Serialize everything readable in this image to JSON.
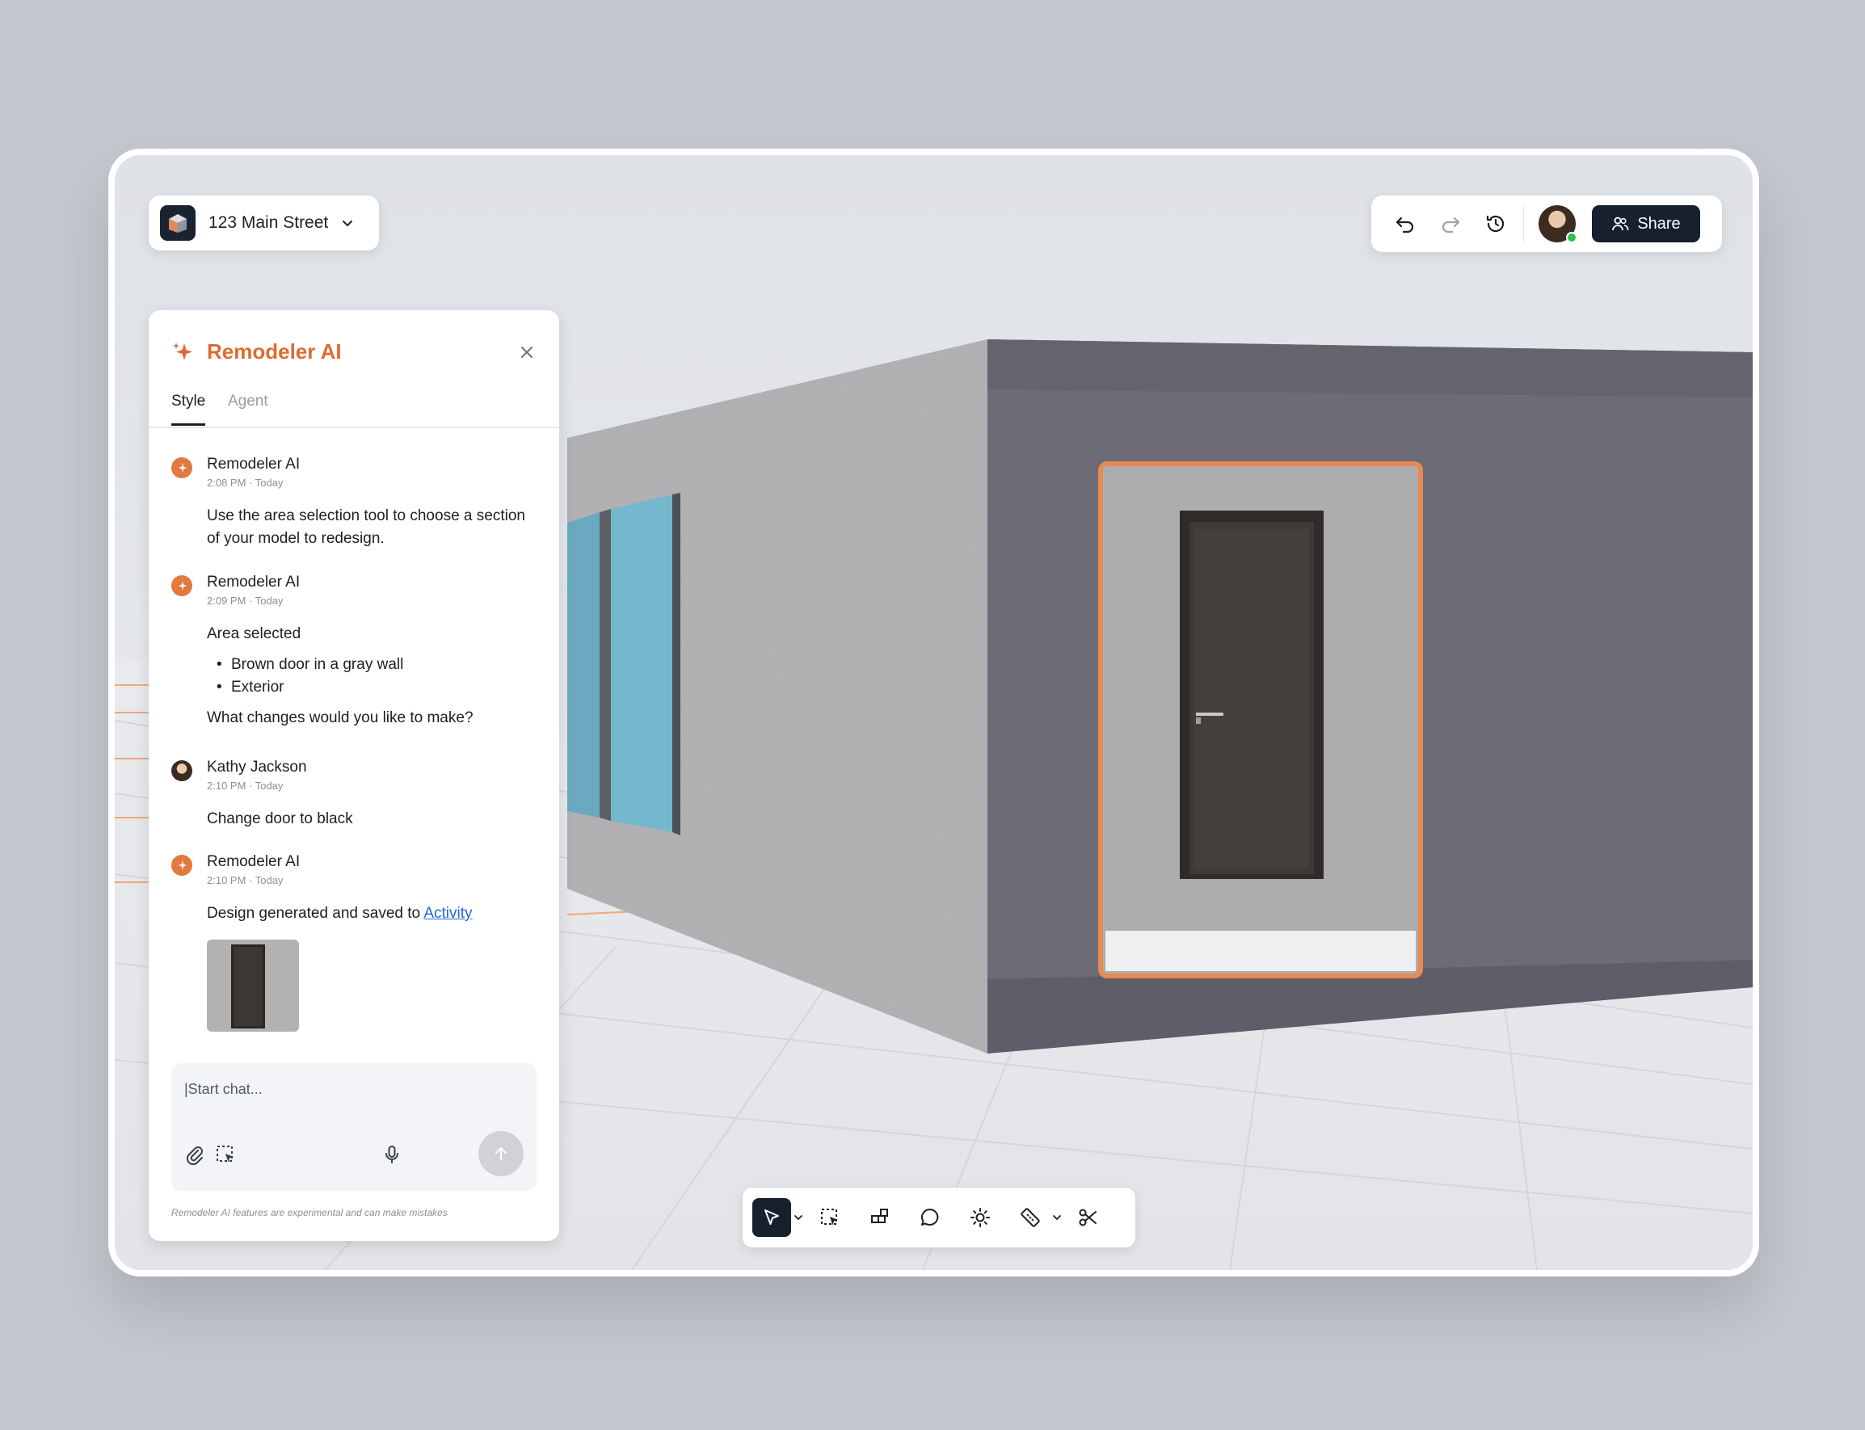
{
  "project": {
    "name": "123 Main Street"
  },
  "toolbar": {
    "share_label": "Share"
  },
  "chat": {
    "title": "Remodeler AI",
    "tabs": [
      "Style",
      "Agent"
    ],
    "messages": [
      {
        "author": "Remodeler AI",
        "time": "2:08 PM · Today",
        "text": "Use the area selection tool to choose a section of your model to redesign."
      },
      {
        "author": "Remodeler AI",
        "time": "2:09 PM · Today",
        "text": "Area selected",
        "bullets": [
          "Brown door in a gray wall",
          "Exterior"
        ],
        "followup": "What changes would you like to make?"
      },
      {
        "author": "Kathy Jackson",
        "time": "2:10 PM · Today",
        "text": "Change door to black"
      },
      {
        "author": "Remodeler AI",
        "time": "2:10 PM · Today",
        "text": "Design generated and saved to ",
        "link": "Activity"
      }
    ],
    "composer_placeholder": "|Start chat...",
    "disclaimer": "Remodeler AI features are experimental and can make mistakes"
  },
  "colors": {
    "accent": "#dc6d31",
    "dark": "#16212d",
    "selection": "#e98a53",
    "online": "#2fbf52"
  },
  "icons": {
    "top": [
      "undo-icon",
      "redo-icon",
      "history-icon"
    ],
    "bottom": [
      "pointer-icon",
      "area-select-icon",
      "components-icon",
      "comment-icon",
      "lighting-icon",
      "measure-icon",
      "cut-icon"
    ]
  }
}
